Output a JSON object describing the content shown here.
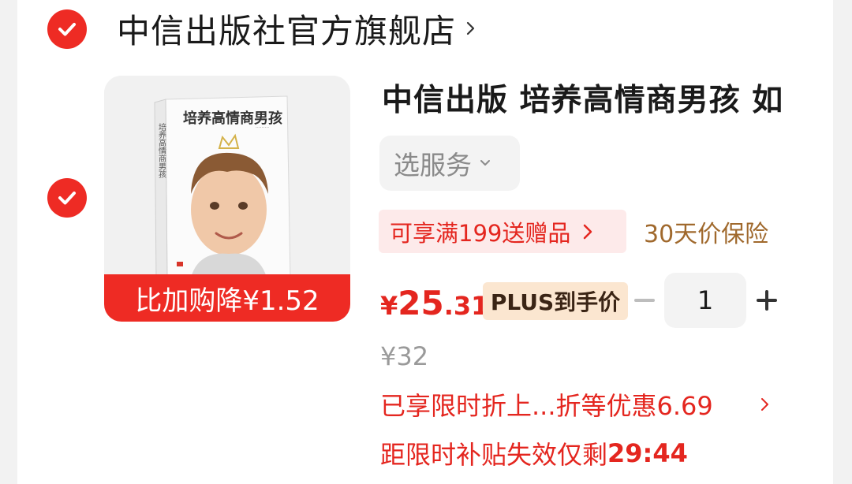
{
  "store": {
    "name": "中信出版社官方旗舰店"
  },
  "item": {
    "cover": {
      "title": "培养高情商男孩",
      "spine": "培养高情商男孩"
    },
    "discount_bar": "比加购降¥1.52",
    "title": "中信出版  培养高情商男孩 如",
    "service": {
      "label": "选服务"
    },
    "gift_tag": "可享满199送赠品",
    "insurance": "30天价保险",
    "price": {
      "currency": "¥",
      "integer": "25",
      "decimal": ".31"
    },
    "plus_tag": "PLUS到手价",
    "quantity": "1",
    "original_price": "¥32",
    "promo_text": "已享限时折上...折等优惠6.69",
    "countdown": {
      "label": "距限时补贴失效仅剩",
      "time": "29:44"
    }
  },
  "colors": {
    "accent": "#ee2b24",
    "price": "#e4261f",
    "insurance": "#a0692d",
    "plus_bg": "#fbe6d0"
  },
  "icons": [
    "check-icon",
    "chevron-right-icon",
    "chevron-down-icon",
    "minus-icon",
    "plus-icon"
  ]
}
